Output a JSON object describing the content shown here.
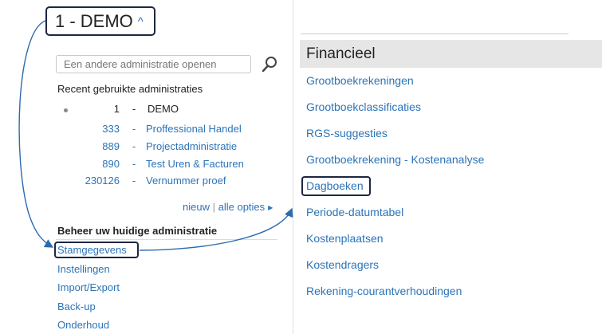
{
  "header": {
    "admin_title": "1 - DEMO"
  },
  "search": {
    "placeholder": "Een andere administratie openen"
  },
  "recent": {
    "title": "Recent gebruikte administraties",
    "items": [
      {
        "number": "1",
        "sep": "-",
        "name": "DEMO",
        "current": true
      },
      {
        "number": "333",
        "sep": "-",
        "name": "Proffessional Handel",
        "current": false
      },
      {
        "number": "889",
        "sep": "-",
        "name": "Projectadministratie",
        "current": false
      },
      {
        "number": "890",
        "sep": "-",
        "name": "Test Uren & Facturen",
        "current": false
      },
      {
        "number": "230126",
        "sep": "-",
        "name": "Vernummer proef",
        "current": false
      }
    ]
  },
  "actions": {
    "new_label": "nieuw",
    "separator": "|",
    "all_options_label": "alle opties"
  },
  "management": {
    "title": "Beheer uw huidige administratie",
    "items": [
      "Stamgegevens",
      "Instellingen",
      "Import/Export",
      "Back-up",
      "Onderhoud"
    ]
  },
  "financial": {
    "title": "Financieel",
    "items": [
      "Grootboekrekeningen",
      "Grootboekclassificaties",
      "RGS-suggesties",
      "Grootboekrekening - Kostenanalyse",
      "Dagboeken",
      "Periode-datumtabel",
      "Kostenplaatsen",
      "Kostendragers",
      "Rekening-courantverhoudingen"
    ]
  },
  "colors": {
    "link": "#2b74b8",
    "highlight_border": "#1c2740",
    "header_bg": "#e6e6e6"
  },
  "icons": {
    "search": "search-icon",
    "chevron": "chevron-up-icon",
    "bullet": "current-admin-bullet-icon",
    "options": "triangle-right-icon"
  }
}
